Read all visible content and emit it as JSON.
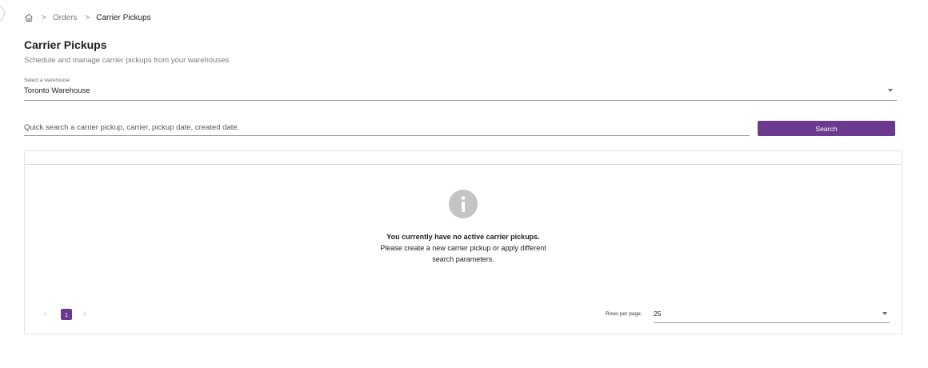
{
  "breadcrumb": {
    "home_icon": "home-icon",
    "separator": ">",
    "items": [
      "Orders",
      "Carrier Pickups"
    ]
  },
  "header": {
    "title": "Carrier Pickups",
    "subtitle": "Schedule and manage carrier pickups from your warehouses"
  },
  "warehouse_select": {
    "label": "Select a warehouse",
    "value": "Toronto Warehouse"
  },
  "search": {
    "placeholder": "Quick search a carrier pickup, carrier, pickup date, created date.",
    "button_label": "Search"
  },
  "empty_state": {
    "icon": "info-icon",
    "title": "You currently have no active carrier pickups.",
    "line1": "Please create a new carrier pickup or apply different",
    "line2": "search parameters."
  },
  "pagination": {
    "prev": "‹",
    "current_page": "1",
    "next": "›",
    "rows_per_page_label": "Rows per page:",
    "rows_per_page_value": "25"
  },
  "colors": {
    "accent": "#6b3a8e",
    "icon_gray": "#c4c4c4"
  }
}
